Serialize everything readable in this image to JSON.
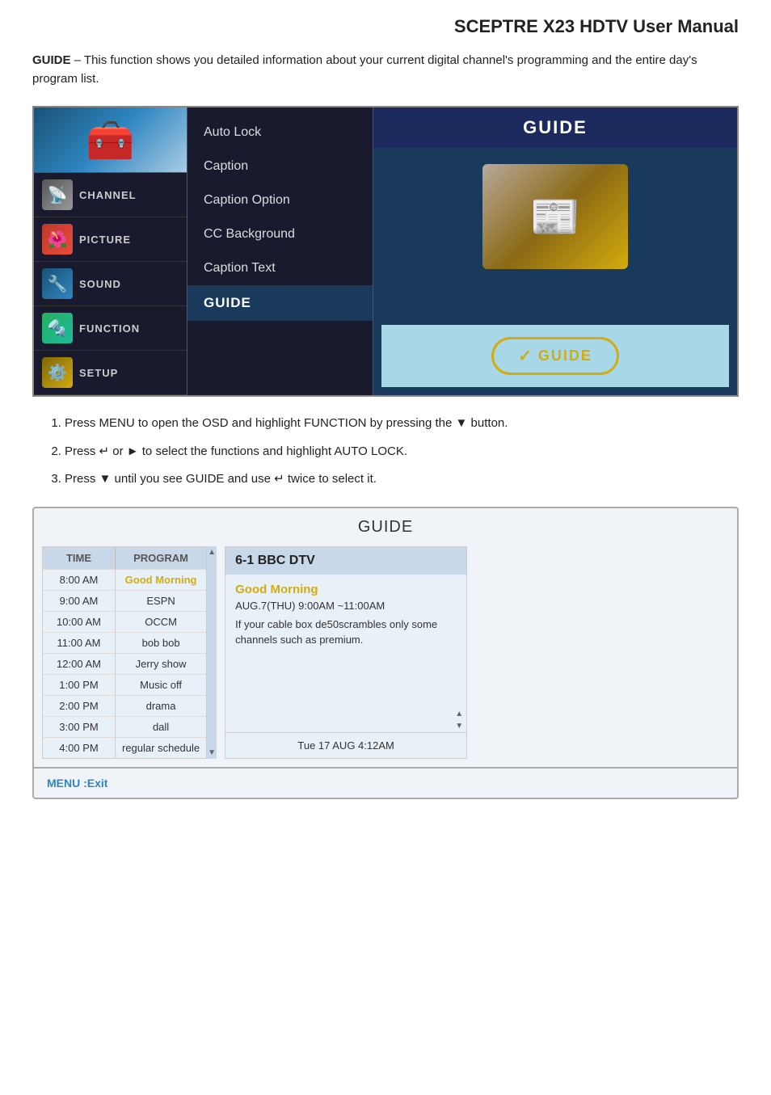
{
  "page": {
    "title": "SCEPTRE X23 HDTV User Manual"
  },
  "intro": {
    "bold_text": "GUIDE",
    "text": " – This function shows you detailed information about your current digital channel's programming and the entire day's program list."
  },
  "osd": {
    "sidebar": {
      "items": [
        {
          "id": "channel",
          "label": "CHANNEL",
          "icon": "🔵"
        },
        {
          "id": "picture",
          "label": "PICTURE",
          "icon": "🎨"
        },
        {
          "id": "sound",
          "label": "SOUND",
          "icon": "🔧"
        },
        {
          "id": "function",
          "label": "FUNCTION",
          "icon": "🔧"
        },
        {
          "id": "setup",
          "label": "SETUP",
          "icon": "⚙️"
        }
      ]
    },
    "menu": {
      "items": [
        {
          "label": "Auto Lock",
          "state": "normal"
        },
        {
          "label": "Caption",
          "state": "normal"
        },
        {
          "label": "Caption Option",
          "state": "normal"
        },
        {
          "label": "CC Background",
          "state": "normal"
        },
        {
          "label": "Caption Text",
          "state": "normal"
        },
        {
          "label": "GUIDE",
          "state": "active"
        }
      ]
    },
    "right": {
      "header": "GUIDE",
      "guide_button_text": "GUIDE"
    }
  },
  "instructions": [
    "Press MENU to open the OSD and highlight FUNCTION by pressing the ▼ button.",
    "Press ↵ or ► to select the functions and highlight AUTO LOCK.",
    "Press ▼ until you see GUIDE and use ↵ twice to select it."
  ],
  "guide": {
    "title": "GUIDE",
    "channel_name": "6-1 BBC DTV",
    "table": {
      "headers": [
        "TIME",
        "PROGRAM"
      ],
      "rows": [
        {
          "time": "8:00 AM",
          "program": "Good Morning",
          "highlight": true
        },
        {
          "time": "9:00 AM",
          "program": "ESPN",
          "highlight": false
        },
        {
          "time": "10:00 AM",
          "program": "OCCM",
          "highlight": false
        },
        {
          "time": "11:00 AM",
          "program": "bob bob",
          "highlight": false
        },
        {
          "time": "12:00 AM",
          "program": "Jerry show",
          "highlight": false
        },
        {
          "time": "1:00 PM",
          "program": "Music off",
          "highlight": false
        },
        {
          "time": "2:00 PM",
          "program": "drama",
          "highlight": false
        },
        {
          "time": "3:00 PM",
          "program": "dall",
          "highlight": false
        },
        {
          "time": "4:00 PM",
          "program": "regular schedule",
          "highlight": false
        }
      ]
    },
    "detail": {
      "program_title": "Good Morning",
      "program_time": "AUG.7(THU) 9:00AM ~11:00AM",
      "program_desc": "If your cable box de50scrambles only some channels such as premium.",
      "timestamp": "Tue 17 AUG 4:12AM"
    },
    "menu_exit": "MENU :Exit"
  }
}
